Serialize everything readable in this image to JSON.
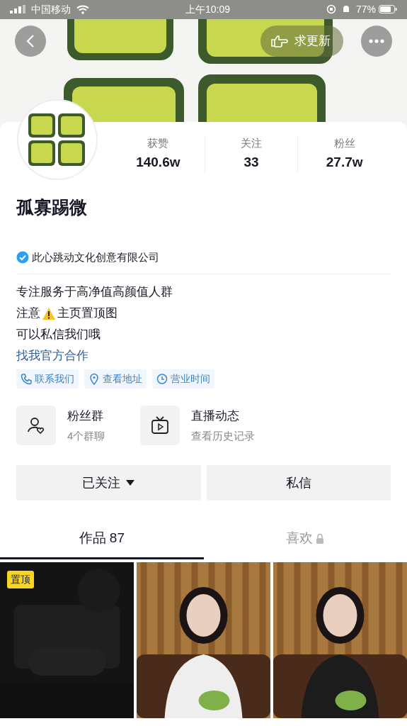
{
  "status_bar": {
    "carrier": "中国移动",
    "time": "上午10:09",
    "battery": "77%"
  },
  "header": {
    "update_button": "求更新"
  },
  "profile": {
    "stats": [
      {
        "label": "获赞",
        "value": "140.6w"
      },
      {
        "label": "关注",
        "value": "33"
      },
      {
        "label": "粉丝",
        "value": "27.7w"
      }
    ],
    "name": "孤寡踢微",
    "verified_org": "此心跳动文化创意有限公司",
    "bio": [
      {
        "kind": "plain",
        "text": "专注服务于高净值高颜值人群"
      },
      {
        "kind": "warning",
        "text": "注意",
        "text_after": "主页置顶图"
      },
      {
        "kind": "plain",
        "text": "可以私信我们哦"
      }
    ],
    "link": "找我官方合作",
    "chips": [
      {
        "kind": "phone",
        "label": "联系我们"
      },
      {
        "kind": "location",
        "label": "查看地址"
      },
      {
        "kind": "clock",
        "label": "营业时间"
      }
    ]
  },
  "features": [
    {
      "kind": "fan-group",
      "title": "粉丝群",
      "subtitle": "4个群聊"
    },
    {
      "kind": "live",
      "title": "直播动态",
      "subtitle": "查看历史记录"
    }
  ],
  "actions": [
    {
      "label": "已关注",
      "dropdown": true
    },
    {
      "label": "私信",
      "dropdown": false
    }
  ],
  "tabs": [
    {
      "label": "作品 87",
      "selected": true,
      "locked": false
    },
    {
      "label": "喜欢",
      "selected": false,
      "locked": true
    }
  ],
  "videos": [
    {
      "kind": "picture",
      "badge": "置顶"
    },
    {
      "kind": "picture"
    },
    {
      "kind": "picture"
    }
  ]
}
